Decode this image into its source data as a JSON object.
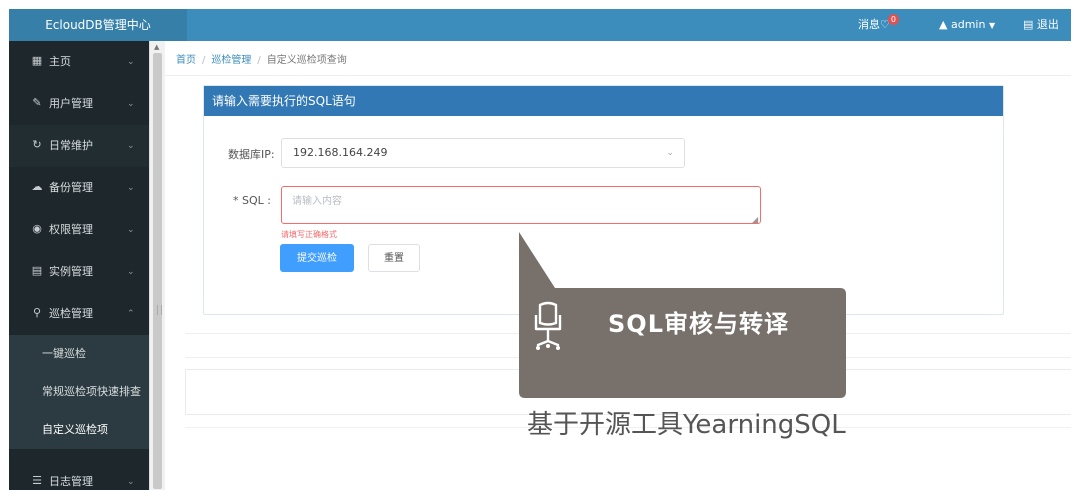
{
  "app": {
    "title": "EcloudDB管理中心"
  },
  "topbar": {
    "messages_label": "消息",
    "message_count": "0",
    "user": "admin",
    "logout_label": "退出"
  },
  "sidebar": {
    "items": [
      {
        "label": "主页",
        "icon": "grid-icon"
      },
      {
        "label": "用户管理",
        "icon": "pencil-icon"
      },
      {
        "label": "日常维护",
        "icon": "refresh-icon"
      },
      {
        "label": "备份管理",
        "icon": "cloud-upload-icon"
      },
      {
        "label": "权限管理",
        "icon": "eye-icon"
      },
      {
        "label": "实例管理",
        "icon": "document-icon"
      },
      {
        "label": "巡检管理",
        "icon": "search-icon"
      },
      {
        "label": "日志管理",
        "icon": "list-icon"
      }
    ],
    "sub_items": [
      {
        "label": "一键巡检"
      },
      {
        "label": "常规巡检项快速排查"
      },
      {
        "label": "自定义巡检项"
      }
    ]
  },
  "breadcrumb": {
    "home": "首页",
    "section": "巡检管理",
    "current": "自定义巡检项查询"
  },
  "panel": {
    "title": "请输入需要执行的SQL语句"
  },
  "form": {
    "db_ip_label": "数据库IP:",
    "db_ip_value": "192.168.164.249",
    "sql_label": "* SQL :",
    "sql_placeholder": "请输入内容",
    "sql_error": "请填写正确格式",
    "submit_label": "提交巡检",
    "reset_label": "重置"
  },
  "callout": {
    "title": "SQL审核与转译",
    "caption": "基于开源工具YearningSQL"
  },
  "colors": {
    "topbar": "#3c8dbc",
    "sidebar": "#1e282c",
    "panel_header": "#3278b4",
    "primary": "#409eff",
    "error": "#f56c6c",
    "callout": "#77706b"
  }
}
